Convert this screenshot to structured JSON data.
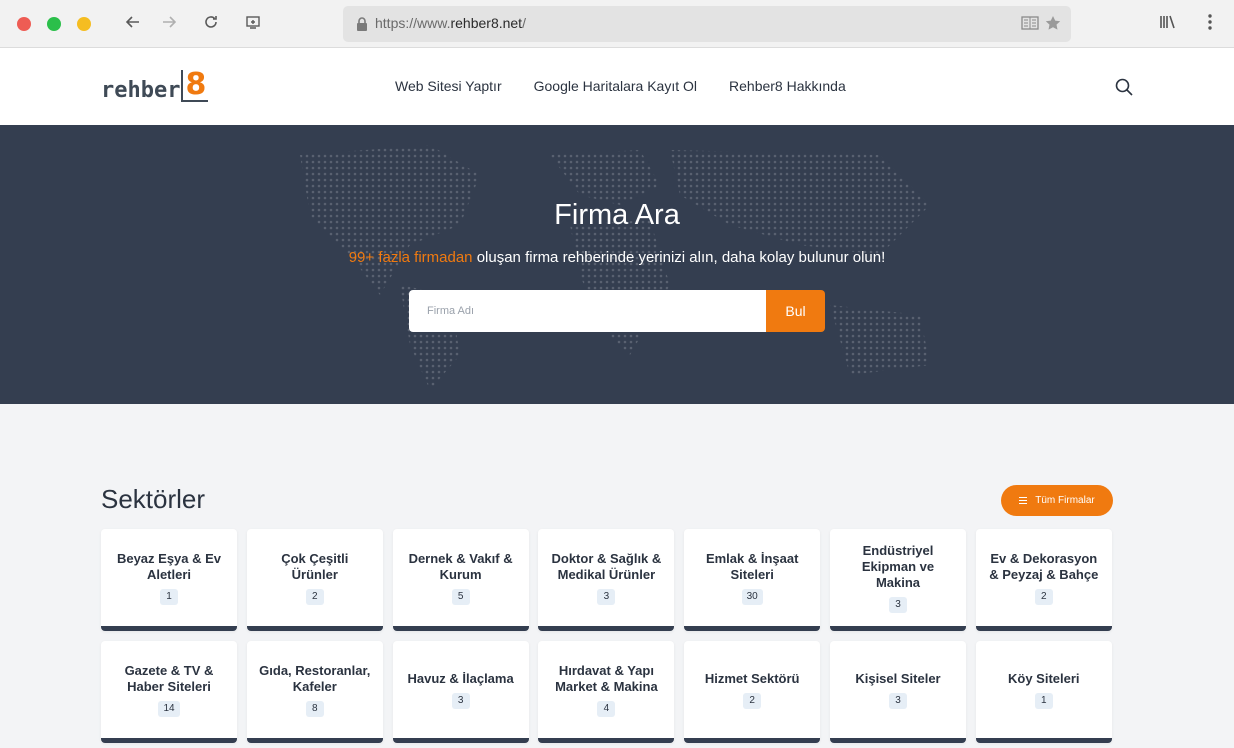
{
  "browser": {
    "url_prefix": "https://www.",
    "url_domain": "rehber8.net",
    "url_suffix": "/"
  },
  "header": {
    "logo_text": "rehber",
    "logo_number": "8",
    "nav": [
      {
        "label": "Web Sitesi Yaptır"
      },
      {
        "label": "Google Haritalara Kayıt Ol"
      },
      {
        "label": "Rehber8 Hakkında"
      }
    ]
  },
  "hero": {
    "title": "Firma Ara",
    "subtitle_accent": "99+ fazla firmadan",
    "subtitle_rest": " oluşan firma rehberinde yerinizi alın, daha kolay bulunur olun!",
    "search_placeholder": "Firma Adı",
    "search_button": "Bul"
  },
  "sectors": {
    "title": "Sektörler",
    "all_button": "Tüm Firmalar",
    "items": [
      {
        "name": "Beyaz Eşya & Ev Aletleri",
        "count": "1"
      },
      {
        "name": "Çok Çeşitli Ürünler",
        "count": "2"
      },
      {
        "name": "Dernek & Vakıf & Kurum",
        "count": "5"
      },
      {
        "name": "Doktor & Sağlık & Medikal Ürünler",
        "count": "3"
      },
      {
        "name": "Emlak & İnşaat Siteleri",
        "count": "30"
      },
      {
        "name": "Endüstriyel Ekipman ve Makina",
        "count": "3"
      },
      {
        "name": "Ev & Dekorasyon & Peyzaj & Bahçe",
        "count": "2"
      },
      {
        "name": "Gazete & TV & Haber Siteleri",
        "count": "14"
      },
      {
        "name": "Gıda, Restoranlar, Kafeler",
        "count": "8"
      },
      {
        "name": "Havuz & İlaçlama",
        "count": "3"
      },
      {
        "name": "Hırdavat & Yapı Market & Makina",
        "count": "4"
      },
      {
        "name": "Hizmet Sektörü",
        "count": "2"
      },
      {
        "name": "Kişisel Siteler",
        "count": "3"
      },
      {
        "name": "Köy Siteleri",
        "count": "1"
      }
    ]
  },
  "colors": {
    "accent": "#f07a10",
    "hero_bg": "#343e50",
    "text_dark": "#2b3340"
  }
}
